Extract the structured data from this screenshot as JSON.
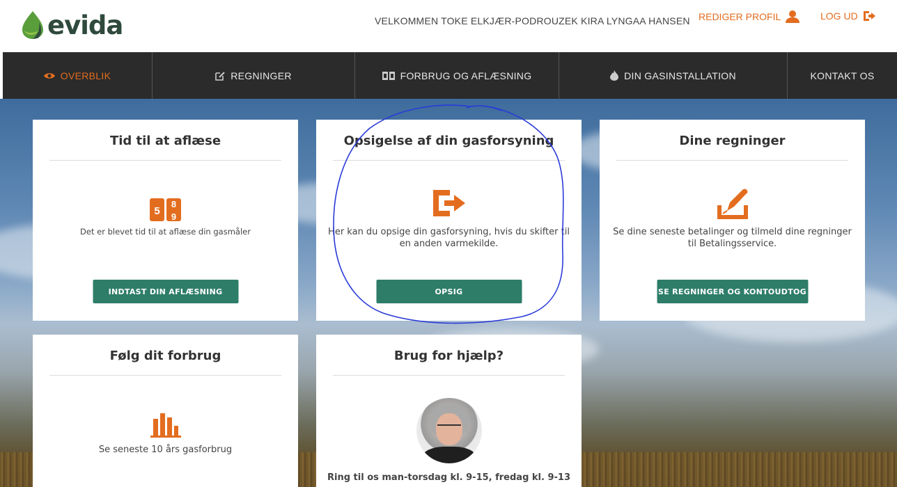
{
  "header": {
    "logo_text": "evida",
    "welcome": "VELKOMMEN TOKE ELKJÆR-PODROUZEK KIRA LYNGAA HANSEN",
    "edit_profile": "REDIGER PROFIL",
    "logout": "LOG UD"
  },
  "nav": {
    "items": [
      {
        "label": "OVERBLIK",
        "icon": "eye-icon",
        "active": true
      },
      {
        "label": "REGNINGER",
        "icon": "edit-icon"
      },
      {
        "label": "FORBRUG OG AFLÆSNING",
        "icon": "meter-icon"
      },
      {
        "label": "DIN GASINSTALLATION",
        "icon": "flame-icon"
      },
      {
        "label": "KONTAKT OS"
      }
    ]
  },
  "cards": {
    "reading": {
      "title": "Tid til at aflæse",
      "icon": "meter-digits-icon",
      "digits": [
        "5",
        "8",
        "9"
      ],
      "text": "Det er blevet tid til at aflæse din gasmåler",
      "button": "INDTAST DIN AFLÆSNING"
    },
    "cancel": {
      "title": "Opsigelse af din gasforsyning",
      "icon": "exit-arrow-icon",
      "text_line1": "Her kan du opsige din gasforsyning, hvis du skifter til",
      "text_line2": "en anden varmekilde.",
      "button": "OPSIG"
    },
    "bills": {
      "title": "Dine regninger",
      "icon": "signature-icon",
      "text_line1": "Se dine seneste betalinger og tilmeld dine regninger",
      "text_line2": "til Betalingsservice.",
      "button": "SE REGNINGER OG KONTOUDTOG"
    },
    "usage": {
      "title": "Følg dit forbrug",
      "icon": "bar-chart-icon",
      "text": "Se seneste 10 års gasforbrug"
    },
    "help": {
      "title": "Brug for hjælp?",
      "text": "Ring til os man-torsdag kl. 9-15, fredag kl. 9-13"
    }
  },
  "colors": {
    "accent": "#e36d1f",
    "button": "#2e7d68",
    "nav_bg": "#2b2b2b",
    "annotation": "#2a3ad8"
  }
}
